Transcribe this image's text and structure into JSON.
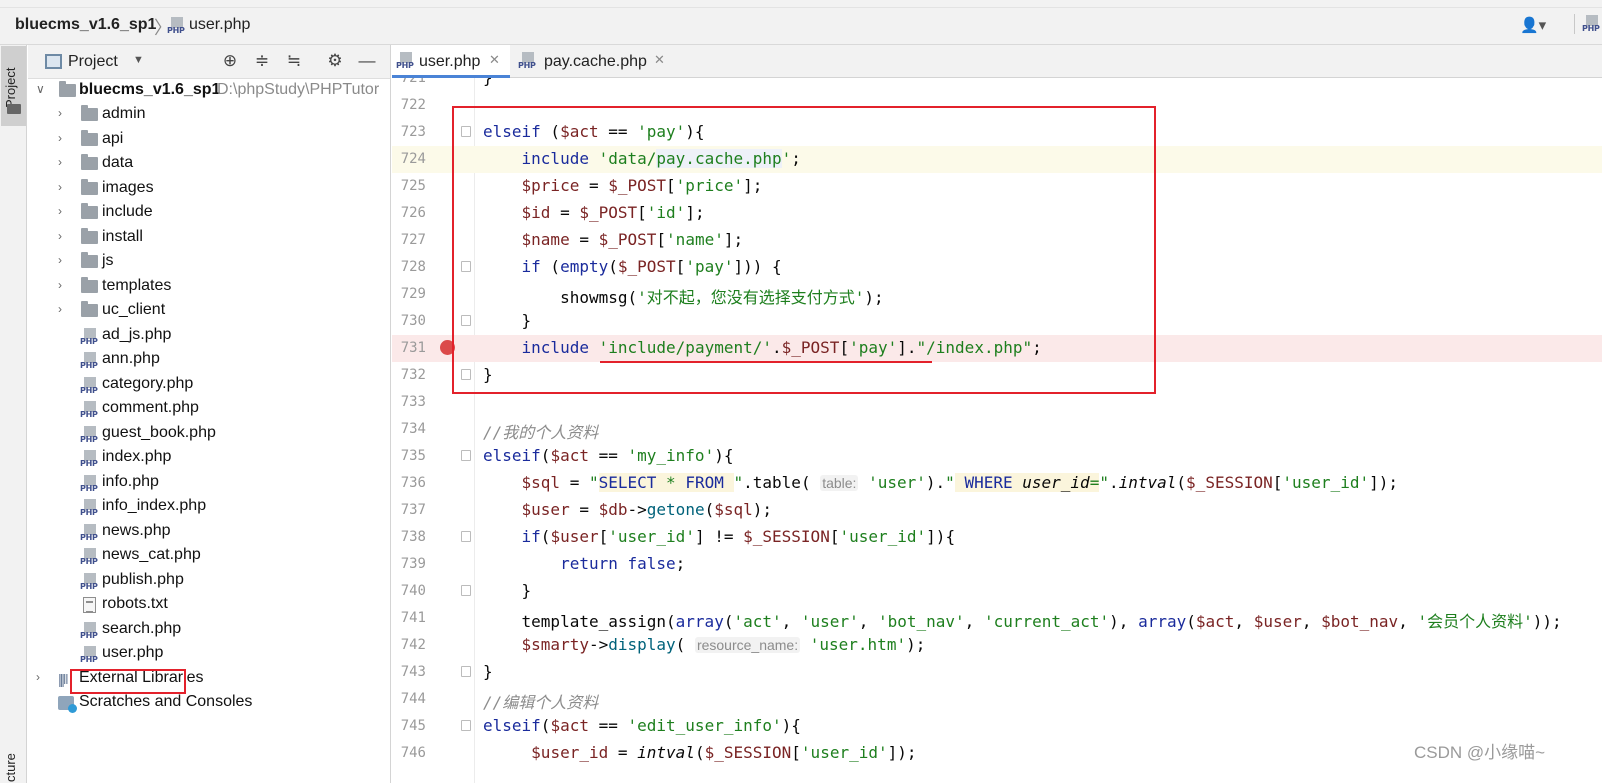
{
  "breadcrumb": {
    "project": "bluecms_v1.6_sp1",
    "file": "user.php"
  },
  "stripe": {
    "project_label": "Project",
    "bottom_label": "cture"
  },
  "panel": {
    "title": "Project",
    "header_icons": [
      "locate-icon",
      "expand-all-icon",
      "collapse-all-icon",
      "gear-icon",
      "hide-icon"
    ]
  },
  "tree": {
    "root": {
      "name": "bluecms_v1.6_sp1",
      "path": "D:\\phpStudy\\PHPTutor"
    },
    "folders": [
      "admin",
      "api",
      "data",
      "images",
      "include",
      "install",
      "js",
      "templates",
      "uc_client"
    ],
    "files": [
      {
        "name": "ad_js.php",
        "type": "php"
      },
      {
        "name": "ann.php",
        "type": "php"
      },
      {
        "name": "category.php",
        "type": "php"
      },
      {
        "name": "comment.php",
        "type": "php"
      },
      {
        "name": "guest_book.php",
        "type": "php"
      },
      {
        "name": "index.php",
        "type": "php"
      },
      {
        "name": "info.php",
        "type": "php"
      },
      {
        "name": "info_index.php",
        "type": "php"
      },
      {
        "name": "news.php",
        "type": "php"
      },
      {
        "name": "news_cat.php",
        "type": "php"
      },
      {
        "name": "publish.php",
        "type": "php"
      },
      {
        "name": "robots.txt",
        "type": "txt"
      },
      {
        "name": "search.php",
        "type": "php"
      },
      {
        "name": "user.php",
        "type": "php"
      }
    ],
    "external": "External Libraries",
    "scratches": "Scratches and Consoles"
  },
  "tabs": [
    {
      "label": "user.php",
      "active": true
    },
    {
      "label": "pay.cache.php",
      "active": false
    }
  ],
  "editor": {
    "line_numbers": [
      "721",
      "722",
      "723",
      "724",
      "725",
      "726",
      "727",
      "728",
      "729",
      "730",
      "731",
      "732",
      "733",
      "734",
      "735",
      "736",
      "737",
      "738",
      "739",
      "740",
      "741",
      "742",
      "743",
      "744",
      "745",
      "746"
    ],
    "current_line": "724",
    "breakpoint_line": "731",
    "hints": {
      "table": "table:",
      "resource_name": "resource_name:"
    }
  },
  "watermark": "CSDN @小缘喵~",
  "colors": {
    "highlight_box": "#e3212b",
    "keyword": "#1a2b9c",
    "string": "#1e7f1e",
    "variable": "#7a2424",
    "breakpoint": "#db4a4a"
  }
}
